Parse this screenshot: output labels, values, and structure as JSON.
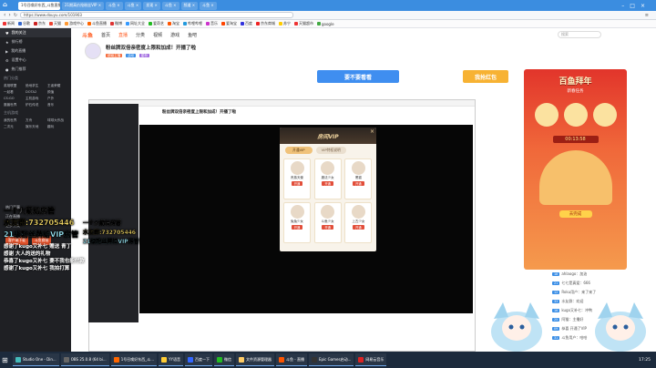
{
  "browser": {
    "tabs": [
      "1号召唤好东西_斗鱼直播 ×",
      "21期高价抢粉丝VIP ×",
      "斗鱼 ×",
      "斗鱼 ×",
      "发现 ×",
      "斗鱼 ×",
      "频道 ×",
      "斗鱼 ×"
    ],
    "address": "https://www.douyu.com/101903",
    "bookmarks": [
      "新闻",
      "谷歌",
      "京东",
      "天猫",
      "游戏中心",
      "斗鱼直播",
      "微博",
      "网址大全",
      "爱奇艺",
      "淘宝",
      "哔哩哔哩",
      "音乐",
      "爱淘宝",
      "百度",
      "京东商城",
      "苏宁",
      "天猫超市",
      "google"
    ]
  },
  "left_app": {
    "items": [
      "我的关注",
      "排行榜",
      "我的直播",
      "设置中心",
      "热门推荐"
    ],
    "section1": "热门分类",
    "grid1": [
      "英雄联盟",
      "绝地求生",
      "王者荣耀",
      "一起看",
      "DOTA2",
      "颜值",
      "CS:GO",
      "主机游戏",
      "户外",
      "魔兽世界",
      "炉石传说",
      "音乐"
    ],
    "section2": "主机游戏",
    "grid2": [
      "我的世界",
      "方舟",
      "球球大作战",
      "二次元",
      "娱乐天地",
      "趣玩"
    ],
    "items2": [
      "热门赛事",
      "正在直播",
      "更多分类"
    ],
    "buttons": [
      "客户端下载",
      "斗鱼商城"
    ]
  },
  "page": {
    "logo": "斗鱼",
    "nav": [
      "首页",
      "直播",
      "分类",
      "视频",
      "游戏",
      "鱼吧"
    ],
    "search_placeholder": "搜索",
    "room_title": "粉丝牌双倍亲密度上限和加成！开播了啦",
    "tags": [
      "超级主播",
      "活动",
      "星粉"
    ],
    "banner_text": "要不要看看",
    "banner_btn": "我抢红包"
  },
  "modal": {
    "title": "房间VIP",
    "tabs": [
      "开通VIP",
      "VIP特权说明"
    ],
    "cards": [
      {
        "label": "贵族天使",
        "btn": "开通"
      },
      {
        "label": "魔法少女",
        "btn": "开通"
      },
      {
        "label": "黑猫",
        "btn": "开通"
      },
      {
        "label": "兔兔少女",
        "btn": "开通"
      },
      {
        "label": "斗鱼少女",
        "btn": "开通"
      },
      {
        "label": "上古少女",
        "btn": "开通"
      }
    ],
    "close": "×"
  },
  "right_panel": {
    "activity_title": "百鱼拜年",
    "activity_sub": "新春任务",
    "activity_btn": "去完成",
    "timer": "00:13:58",
    "chat": [
      {
        "lvl": "18",
        "text": "ahlaogo：加油"
      },
      {
        "lvl": "21",
        "text": "七七是真爱：666"
      },
      {
        "lvl": "12",
        "text": "Roku用户：来了来了"
      },
      {
        "lvl": "33",
        "text": "水友群：欢迎"
      },
      {
        "lvl": "16",
        "text": "kugo又补七：冲鸭"
      },
      {
        "lvl": "25",
        "text": "阿猫：主播好"
      },
      {
        "lvl": "09",
        "text": "恭喜 开通了VIP"
      },
      {
        "lvl": "31",
        "text": "斗鱼用户：哈哈"
      }
    ]
  },
  "overlay": {
    "left_line1": "一个火箭给房管",
    "left_line2": "水友群:732705446",
    "left_line3": "21级粉丝牌给VIP房管",
    "small_lines": [
      "感谢了kugo又补七 赠送 青丁",
      "感谢 大人的送的礼物",
      "恭喜了kugo又补七 要不我也能付款",
      "感谢了kugo又补七 我拍打算"
    ],
    "inner_line1": "一个火箭给房管",
    "inner_line2": "水友群:732705446",
    "inner_line3": "21级粉丝牌给VIP房管"
  },
  "taskbar": {
    "items": [
      "Studio One - Din...",
      "OBS 25.0.8 (64 bi...",
      "1号召唤好东西_斗...",
      "YY语音",
      "百度一下",
      "微信",
      "文件资源管理器",
      "斗鱼 - 直播",
      "Epic Games启动...",
      "网易云音乐"
    ],
    "time": "17:25"
  },
  "colors": {
    "brand": "#ff5d23",
    "browser_blue": "#3b8de0",
    "vip_gold": "#f3d7a1",
    "activity_red": "#e2352b"
  }
}
